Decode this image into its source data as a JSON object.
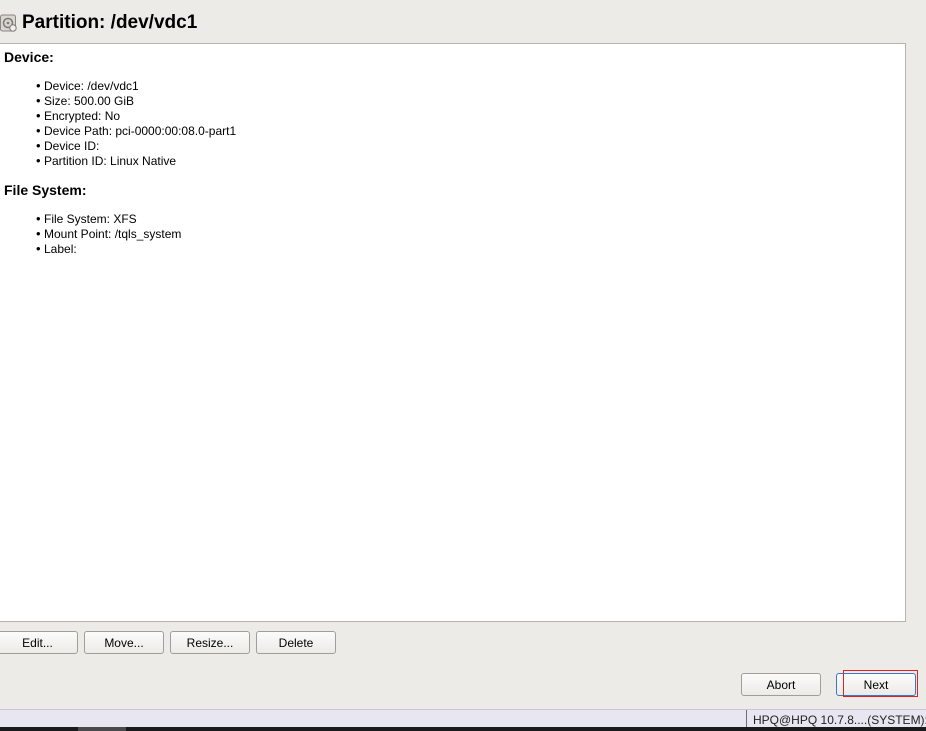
{
  "header": {
    "title": "Partition: /dev/vdc1",
    "icon": "partition-icon"
  },
  "device_section": {
    "heading": "Device:",
    "items": [
      "Device: /dev/vdc1",
      "Size: 500.00 GiB",
      "Encrypted: No",
      "Device Path: pci-0000:00:08.0-part1",
      "Device ID:",
      "Partition ID: Linux Native"
    ]
  },
  "filesystem_section": {
    "heading": "File System:",
    "items": [
      "File System: XFS",
      "Mount Point: /tqls_system",
      "Label:"
    ]
  },
  "actions": {
    "edit": "Edit...",
    "move": "Move...",
    "resize": "Resize...",
    "delete": "Delete"
  },
  "navigation": {
    "abort": "Abort",
    "next": "Next"
  },
  "taskbar": {
    "text": "HPQ@HPQ 10.7.8....(SYSTEM):"
  }
}
